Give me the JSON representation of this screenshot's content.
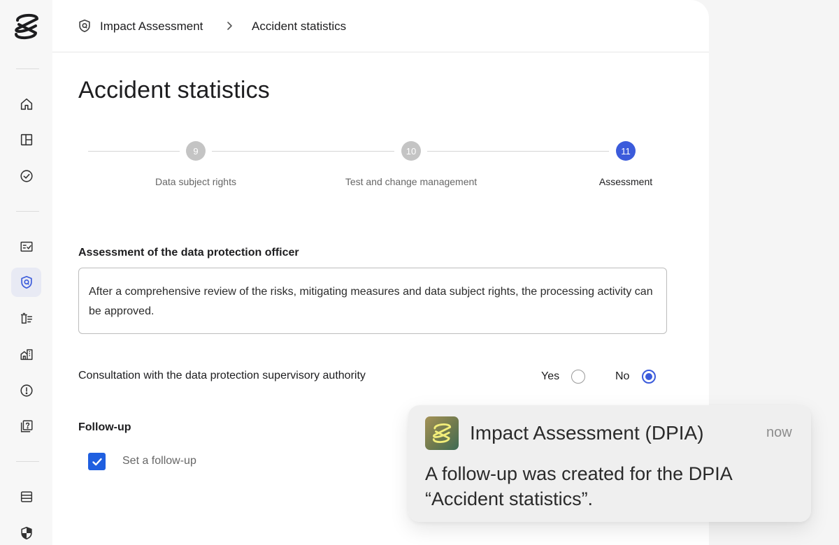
{
  "breadcrumb": {
    "root": "Impact Assessment",
    "current": "Accident statistics"
  },
  "page": {
    "title": "Accident statistics"
  },
  "stepper": {
    "steps": [
      {
        "number": "9",
        "label": "Data subject rights",
        "state": "done"
      },
      {
        "number": "10",
        "label": "Test and change management",
        "state": "done"
      },
      {
        "number": "11",
        "label": "Assessment",
        "state": "current"
      }
    ]
  },
  "assessment": {
    "label": "Assessment of the data protection officer",
    "text": "After a comprehensive review of the risks, mitigating measures and data subject rights, the processing activity can be approved."
  },
  "consultation": {
    "label": "Consultation with the data protection supervisory authority",
    "yes_label": "Yes",
    "no_label": "No",
    "selected": "No"
  },
  "followup": {
    "label": "Follow-up",
    "checkbox_label": "Set a follow-up",
    "checked": true
  },
  "notification": {
    "title": "Impact Assessment (DPIA)",
    "time": "now",
    "body": "A follow-up was created for the DPIA “Accident statistics”."
  },
  "sidebar": {
    "icons": [
      "home-icon",
      "dashboard-icon",
      "tasks-icon",
      "checklist-icon",
      "shield-icon",
      "records-icon",
      "building-icon",
      "alert-icon",
      "help-icon",
      "database-icon",
      "security-shield-icon"
    ],
    "active": "shield-icon"
  },
  "colors": {
    "accent": "#3b5bdb",
    "checkbox": "#1f5fe0"
  }
}
